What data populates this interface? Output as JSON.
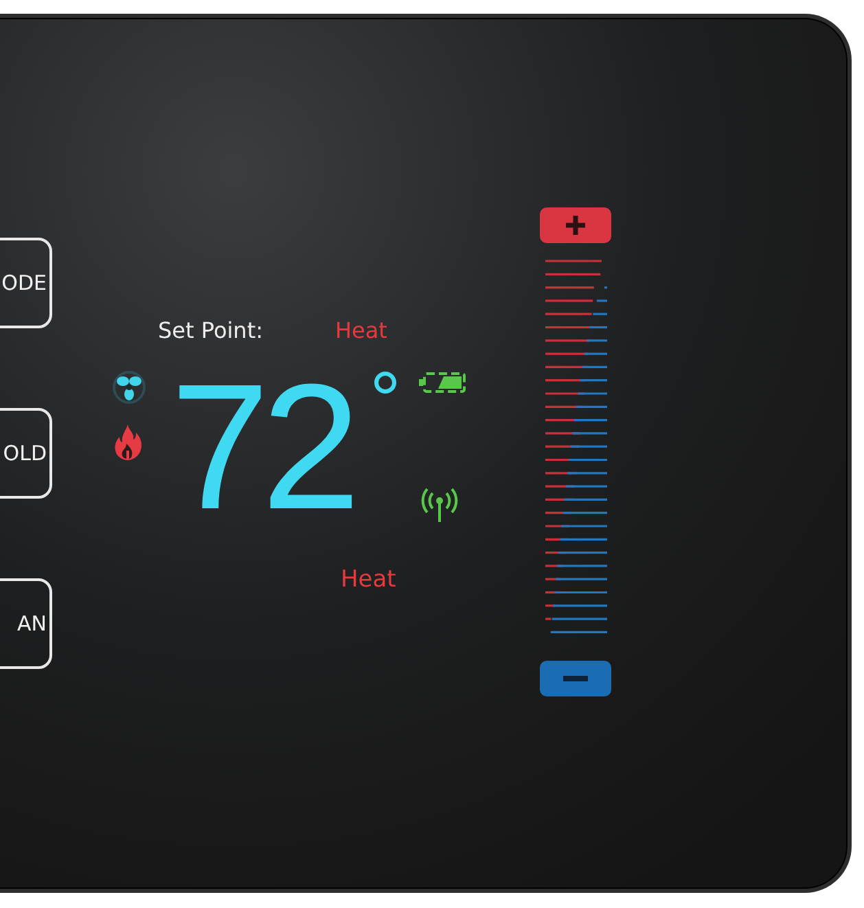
{
  "side_buttons": [
    {
      "label": "ODE"
    },
    {
      "label": "OLD"
    },
    {
      "label": "AN"
    }
  ],
  "set_point": {
    "label": "Set Point:",
    "mode": "Heat"
  },
  "temperature": "72",
  "status": "Heat"
}
